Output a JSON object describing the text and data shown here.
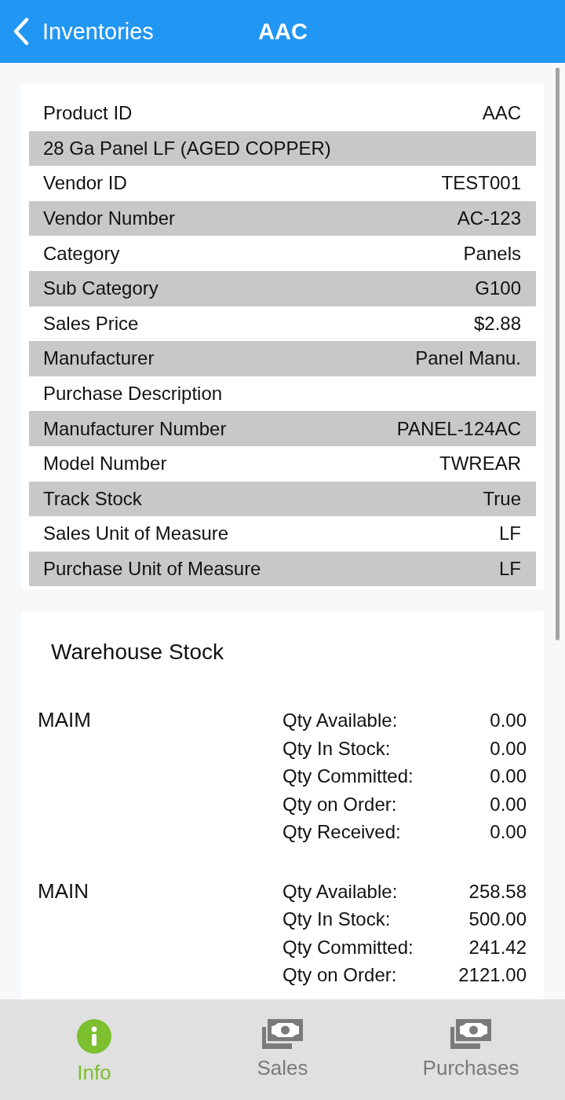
{
  "nav_bar": {
    "back_label": "Inventories",
    "title": "AAC"
  },
  "details": [
    {
      "label": "Product ID",
      "value": "AAC"
    },
    {
      "label": "28 Ga Panel LF (AGED COPPER)"
    },
    {
      "label": "Vendor ID",
      "value": "TEST001"
    },
    {
      "label": "Vendor Number",
      "value": "AC-123"
    },
    {
      "label": "Category",
      "value": "Panels"
    },
    {
      "label": "Sub Category",
      "value": "G100"
    },
    {
      "label": "Sales Price",
      "value": "$2.88"
    },
    {
      "label": "Manufacturer",
      "value": "Panel Manu."
    },
    {
      "label": "Purchase Description"
    },
    {
      "label": "Manufacturer Number",
      "value": "PANEL-124AC"
    },
    {
      "label": "Model Number",
      "value": "TWREAR"
    },
    {
      "label": "Track Stock",
      "value": "True"
    },
    {
      "label": "Sales Unit of Measure",
      "value": "LF"
    },
    {
      "label": "Purchase Unit of Measure",
      "value": "LF"
    }
  ],
  "warehouse_stock": {
    "title": "Warehouse Stock",
    "warehouses": [
      {
        "name": "MAIM",
        "quantities": [
          {
            "label": "Qty Available:",
            "value": "0.00"
          },
          {
            "label": "Qty In Stock:",
            "value": "0.00"
          },
          {
            "label": "Qty Committed:",
            "value": "0.00"
          },
          {
            "label": "Qty on Order:",
            "value": "0.00"
          },
          {
            "label": "Qty Received:",
            "value": "0.00"
          }
        ]
      },
      {
        "name": "MAIN",
        "quantities": [
          {
            "label": "Qty Available:",
            "value": "258.58"
          },
          {
            "label": "Qty In Stock:",
            "value": "500.00"
          },
          {
            "label": "Qty Committed:",
            "value": "241.42"
          },
          {
            "label": "Qty on Order:",
            "value": "2121.00"
          }
        ]
      }
    ]
  },
  "tab_bar": [
    {
      "kind": "info",
      "label": "Info",
      "selected": true
    },
    {
      "kind": "money",
      "label": "Sales",
      "selected": false
    },
    {
      "kind": "money",
      "label": "Purchases",
      "selected": false
    }
  ]
}
